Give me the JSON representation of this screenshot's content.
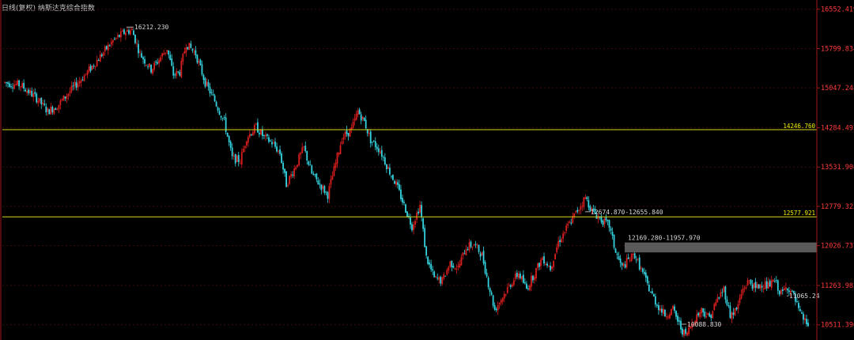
{
  "title": "日线(复权) 纳斯达克综合指数",
  "colors": {
    "background": "#000000",
    "up": "#d81e1e",
    "down": "#34d3df",
    "axis": "#a01818",
    "grid": "#3a0a0a",
    "tick_label": "#ff3b3b",
    "hline": "#d8d81a",
    "zone": "#5a5a5a",
    "annotation": "#d8d8d8"
  },
  "chart_data": {
    "type": "candlestick",
    "title": "日线(复权) 纳斯达克综合指数",
    "ylim": [
      10250,
      16700
    ],
    "y_ticks": [
      "16552.419",
      "15799.834",
      "15047.248",
      "14284.493",
      "13531.908",
      "12779.322",
      "12026.737",
      "11263.982",
      "10511.396"
    ],
    "horizontal_lines": [
      {
        "value": 14246.76,
        "label": "14246.760"
      },
      {
        "value": 12577.921,
        "label": "12577.921"
      }
    ],
    "zones": [
      {
        "from": 12026.737,
        "to": 11957.97,
        "label": "12169.280-11957.970"
      }
    ],
    "annotations": [
      {
        "value": 16212.23,
        "text": "16212.230",
        "kind": "high"
      },
      {
        "value": 10088.83,
        "text": "10088.830",
        "kind": "low"
      },
      {
        "value": 12674.87,
        "text": "12674.870-12655.840",
        "kind": "gap"
      },
      {
        "value": 11065.24,
        "text": "11065.24",
        "kind": "level"
      }
    ],
    "trend": [
      [
        0,
        15150
      ],
      [
        10,
        15100
      ],
      [
        20,
        14850
      ],
      [
        27,
        14600
      ],
      [
        33,
        14700
      ],
      [
        43,
        15050
      ],
      [
        52,
        15350
      ],
      [
        60,
        15650
      ],
      [
        68,
        15950
      ],
      [
        76,
        16130
      ],
      [
        80,
        16150
      ],
      [
        85,
        15700
      ],
      [
        92,
        15400
      ],
      [
        96,
        15550
      ],
      [
        102,
        15800
      ],
      [
        106,
        15300
      ],
      [
        110,
        15350
      ],
      [
        114,
        15900
      ],
      [
        120,
        15700
      ],
      [
        126,
        15150
      ],
      [
        132,
        14800
      ],
      [
        138,
        14400
      ],
      [
        143,
        13700
      ],
      [
        148,
        13650
      ],
      [
        152,
        14100
      ],
      [
        158,
        14300
      ],
      [
        163,
        14100
      ],
      [
        168,
        14000
      ],
      [
        173,
        13800
      ],
      [
        177,
        13200
      ],
      [
        182,
        13500
      ],
      [
        188,
        13900
      ],
      [
        193,
        13400
      ],
      [
        198,
        13200
      ],
      [
        203,
        13000
      ],
      [
        208,
        13600
      ],
      [
        212,
        14100
      ],
      [
        218,
        14250
      ],
      [
        222,
        14600
      ],
      [
        226,
        14400
      ],
      [
        230,
        14050
      ],
      [
        236,
        13850
      ],
      [
        241,
        13500
      ],
      [
        246,
        13200
      ],
      [
        251,
        12800
      ],
      [
        256,
        12400
      ],
      [
        261,
        12800
      ],
      [
        265,
        11800
      ],
      [
        270,
        11400
      ],
      [
        275,
        11350
      ],
      [
        280,
        11700
      ],
      [
        285,
        11600
      ],
      [
        290,
        12000
      ],
      [
        295,
        12050
      ],
      [
        300,
        11850
      ],
      [
        304,
        11300
      ],
      [
        308,
        10800
      ],
      [
        312,
        11000
      ],
      [
        318,
        11300
      ],
      [
        323,
        11500
      ],
      [
        328,
        11200
      ],
      [
        333,
        11500
      ],
      [
        338,
        11800
      ],
      [
        343,
        11600
      ],
      [
        348,
        12100
      ],
      [
        354,
        12400
      ],
      [
        360,
        12700
      ],
      [
        365,
        12950
      ],
      [
        369,
        12700
      ],
      [
        374,
        12550
      ],
      [
        380,
        12400
      ],
      [
        384,
        11900
      ],
      [
        388,
        11600
      ],
      [
        392,
        11750
      ],
      [
        396,
        11850
      ],
      [
        401,
        11500
      ],
      [
        405,
        11200
      ],
      [
        410,
        10900
      ],
      [
        415,
        10700
      ],
      [
        420,
        10800
      ],
      [
        425,
        10450
      ],
      [
        428,
        10300
      ],
      [
        433,
        10600
      ],
      [
        438,
        10800
      ],
      [
        443,
        10650
      ],
      [
        448,
        11000
      ],
      [
        452,
        11200
      ],
      [
        456,
        10700
      ],
      [
        460,
        10800
      ],
      [
        464,
        11200
      ],
      [
        468,
        11350
      ],
      [
        472,
        11200
      ],
      [
        476,
        11300
      ],
      [
        480,
        11250
      ],
      [
        484,
        11350
      ],
      [
        488,
        11100
      ],
      [
        492,
        11250
      ],
      [
        496,
        11050
      ],
      [
        500,
        10700
      ],
      [
        504,
        10550
      ],
      [
        506,
        10450
      ]
    ],
    "n_candles": 506
  }
}
